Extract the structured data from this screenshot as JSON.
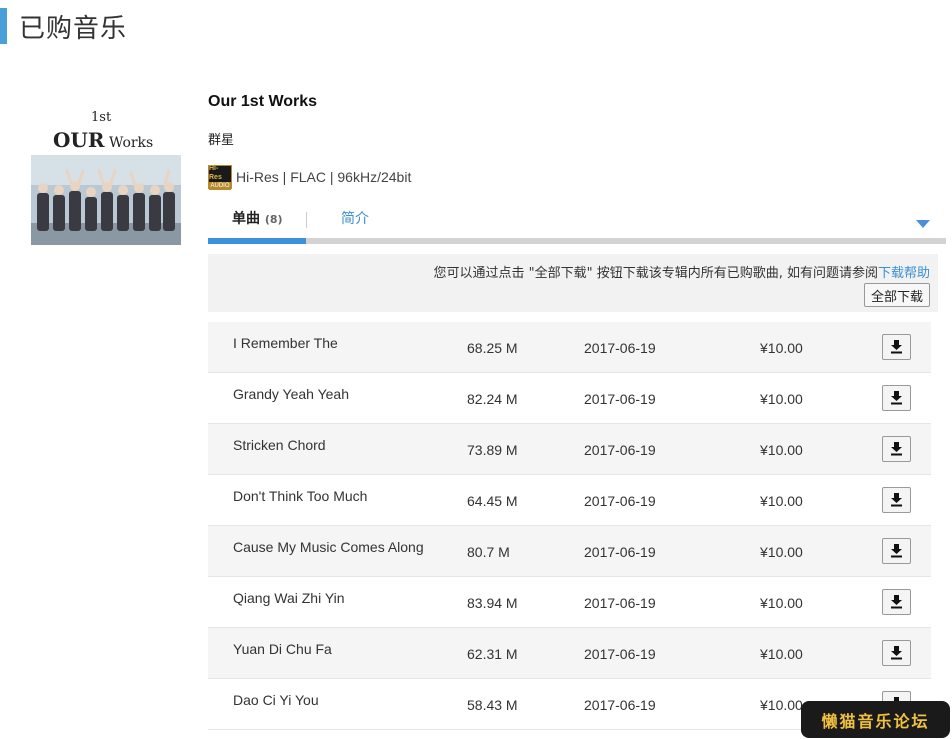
{
  "page": {
    "title": "已购音乐"
  },
  "album": {
    "title": "Our 1st Works",
    "artist": "群星",
    "hires_badge_top": "Hi-Res",
    "hires_badge_bottom": "AUDIO",
    "format": "Hi-Res | FLAC | 96kHz/24bit",
    "cover_text": "OUR",
    "cover_text2": "Works",
    "cover_text3": "1st"
  },
  "tabs": {
    "songs_label": "单曲",
    "songs_count": "(8)",
    "intro_label": "简介"
  },
  "notice": {
    "text": "您可以通过点击 \"全部下载\" 按钮下载该专辑内所有已购歌曲, 如有问题请参阅",
    "help_link": "下载帮助",
    "download_all": "全部下载"
  },
  "tracks": [
    {
      "name": "I Remember The",
      "size": "68.25 M",
      "date": "2017-06-19",
      "price": "¥10.00"
    },
    {
      "name": "Grandy Yeah Yeah",
      "size": "82.24 M",
      "date": "2017-06-19",
      "price": "¥10.00"
    },
    {
      "name": "Stricken Chord",
      "size": "73.89 M",
      "date": "2017-06-19",
      "price": "¥10.00"
    },
    {
      "name": "Don't Think Too Much",
      "size": "64.45 M",
      "date": "2017-06-19",
      "price": "¥10.00"
    },
    {
      "name": "Cause My Music Comes Along",
      "size": "80.7 M",
      "date": "2017-06-19",
      "price": "¥10.00"
    },
    {
      "name": "Qiang Wai Zhi Yin",
      "size": "83.94 M",
      "date": "2017-06-19",
      "price": "¥10.00"
    },
    {
      "name": "Yuan Di Chu Fa",
      "size": "62.31 M",
      "date": "2017-06-19",
      "price": "¥10.00"
    },
    {
      "name": "Dao Ci Yi You",
      "size": "58.43 M",
      "date": "2017-06-19",
      "price": "¥10.00"
    }
  ],
  "watermark": "懒猫音乐论坛",
  "colors": {
    "accent": "#3c92da",
    "link": "#3b8fd3",
    "watermark_bg": "#1a1a1a",
    "watermark_text": "#f0c040"
  }
}
